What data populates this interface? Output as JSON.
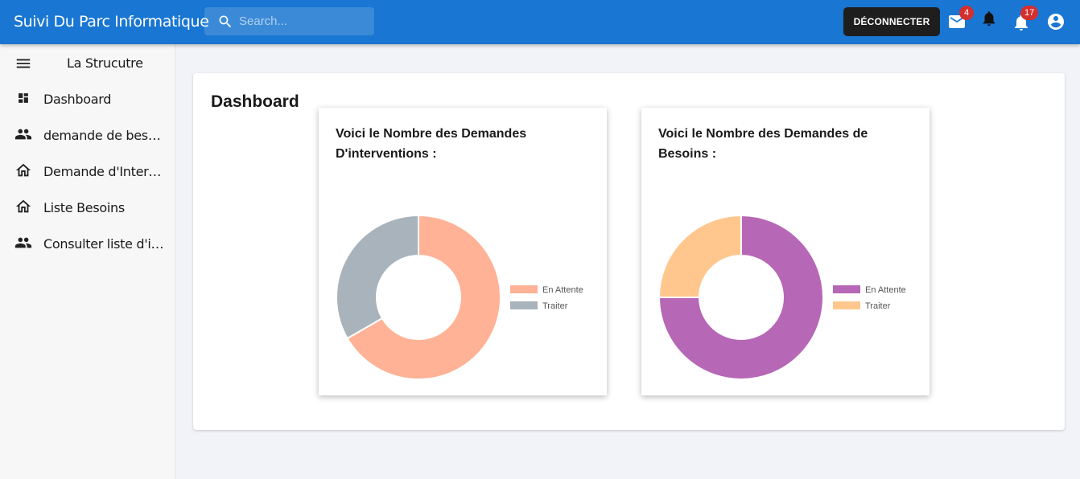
{
  "app": {
    "title": "Suivi Du Parc Informatique",
    "search_placeholder": "Search...",
    "logout_label": "DÉCONNECTER",
    "mail_badge": "4",
    "notif_badge": "17"
  },
  "sidebar": {
    "title": "La Strucutre",
    "items": [
      {
        "label": "Dashboard",
        "icon": "dashboard-icon"
      },
      {
        "label": "demande de besoin",
        "icon": "people-icon"
      },
      {
        "label": "Demande d'Intervention",
        "icon": "home-icon"
      },
      {
        "label": "Liste Besoins",
        "icon": "home-icon"
      },
      {
        "label": "Consulter liste d'interventions",
        "icon": "people-icon"
      }
    ]
  },
  "main": {
    "title": "Dashboard"
  },
  "chart_data": [
    {
      "type": "pie",
      "title": "Voici le Nombre des Demandes D'interventions :",
      "categories": [
        "En Attente",
        "Traiter"
      ],
      "values": [
        2,
        1
      ],
      "colors": [
        "#ffb296",
        "#a9b3bb"
      ],
      "legend": "right"
    },
    {
      "type": "pie",
      "title": "Voici le Nombre des Demandes de Besoins :",
      "categories": [
        "En Attente",
        "Traiter"
      ],
      "values": [
        3,
        1
      ],
      "colors": [
        "#b667b6",
        "#ffc78e"
      ],
      "legend": "right"
    }
  ]
}
